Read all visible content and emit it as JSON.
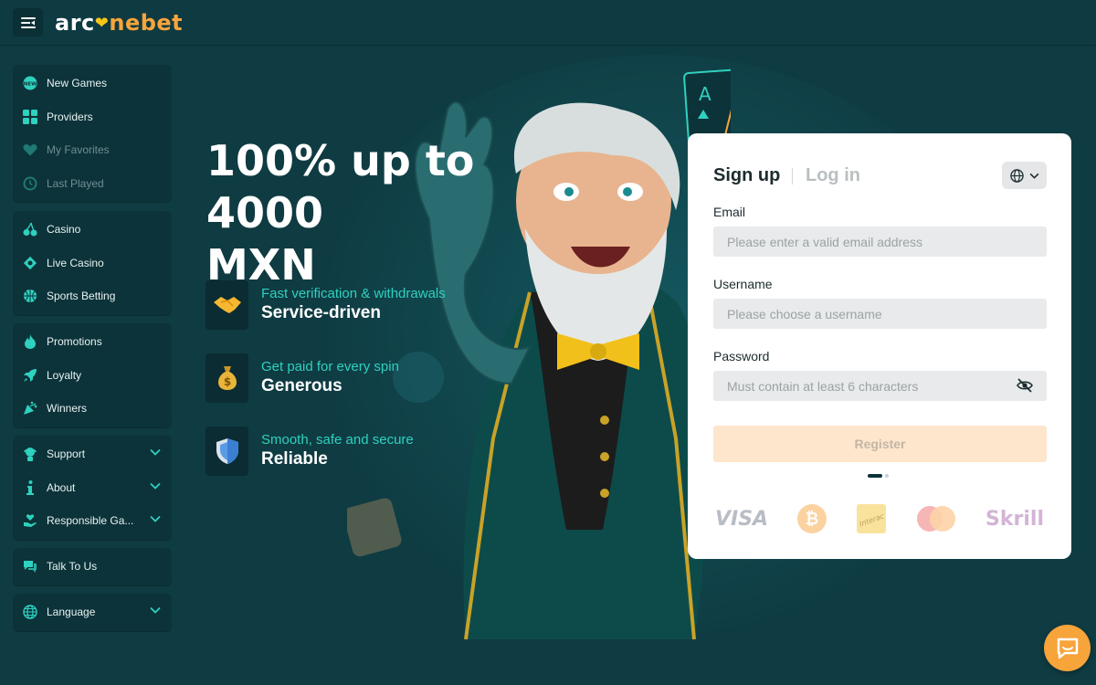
{
  "brand": {
    "logo_part1": "arc",
    "logo_part2": "nebet",
    "accent": "#f7a43a",
    "teal": "#2fd1bf",
    "bg": "#0f3b42"
  },
  "header": {
    "menu_icon": "hamburger-icon"
  },
  "sidebar": {
    "groups": [
      {
        "items": [
          {
            "label": "New Games",
            "icon": "new-badge-icon"
          },
          {
            "label": "Providers",
            "icon": "grid-icon"
          },
          {
            "label": "My Favorites",
            "icon": "heart-icon"
          },
          {
            "label": "Last Played",
            "icon": "history-icon"
          }
        ]
      },
      {
        "items": [
          {
            "label": "Casino",
            "icon": "cherries-icon"
          },
          {
            "label": "Live Casino",
            "icon": "chip-icon"
          },
          {
            "label": "Sports Betting",
            "icon": "basketball-icon"
          }
        ]
      },
      {
        "items": [
          {
            "label": "Promotions",
            "icon": "flame-icon"
          },
          {
            "label": "Loyalty",
            "icon": "rocket-icon"
          },
          {
            "label": "Winners",
            "icon": "confetti-icon"
          }
        ]
      },
      {
        "items": [
          {
            "label": "Support",
            "icon": "support-icon"
          },
          {
            "label": "About",
            "icon": "info-icon"
          },
          {
            "label": "Responsible Ga...",
            "icon": "hand-heart-icon"
          }
        ]
      },
      {
        "items": [
          {
            "label": "Talk To Us",
            "icon": "chat-bubbles-icon"
          }
        ]
      },
      {
        "items": [
          {
            "label": "Language",
            "icon": "globe-icon"
          }
        ]
      }
    ]
  },
  "hero": {
    "title_line1": "100% up to 4000",
    "title_line2": "MXN",
    "features": [
      {
        "sub": "Fast verification & withdrawals",
        "main": "Service-driven",
        "icon": "handshake-icon"
      },
      {
        "sub": "Get paid for every spin",
        "main": "Generous",
        "icon": "money-bag-icon"
      },
      {
        "sub": "Smooth, safe and secure",
        "main": "Reliable",
        "icon": "shield-icon"
      }
    ]
  },
  "form": {
    "tab_signup": "Sign up",
    "tab_login": "Log in",
    "email_label": "Email",
    "email_placeholder": "Please enter a valid email address",
    "username_label": "Username",
    "username_placeholder": "Please choose a username",
    "password_label": "Password",
    "password_placeholder": "Must contain at least 6 characters",
    "register_label": "Register",
    "payments": {
      "visa": "VISA",
      "skrill": "Skrill",
      "interac": "Interac"
    }
  }
}
